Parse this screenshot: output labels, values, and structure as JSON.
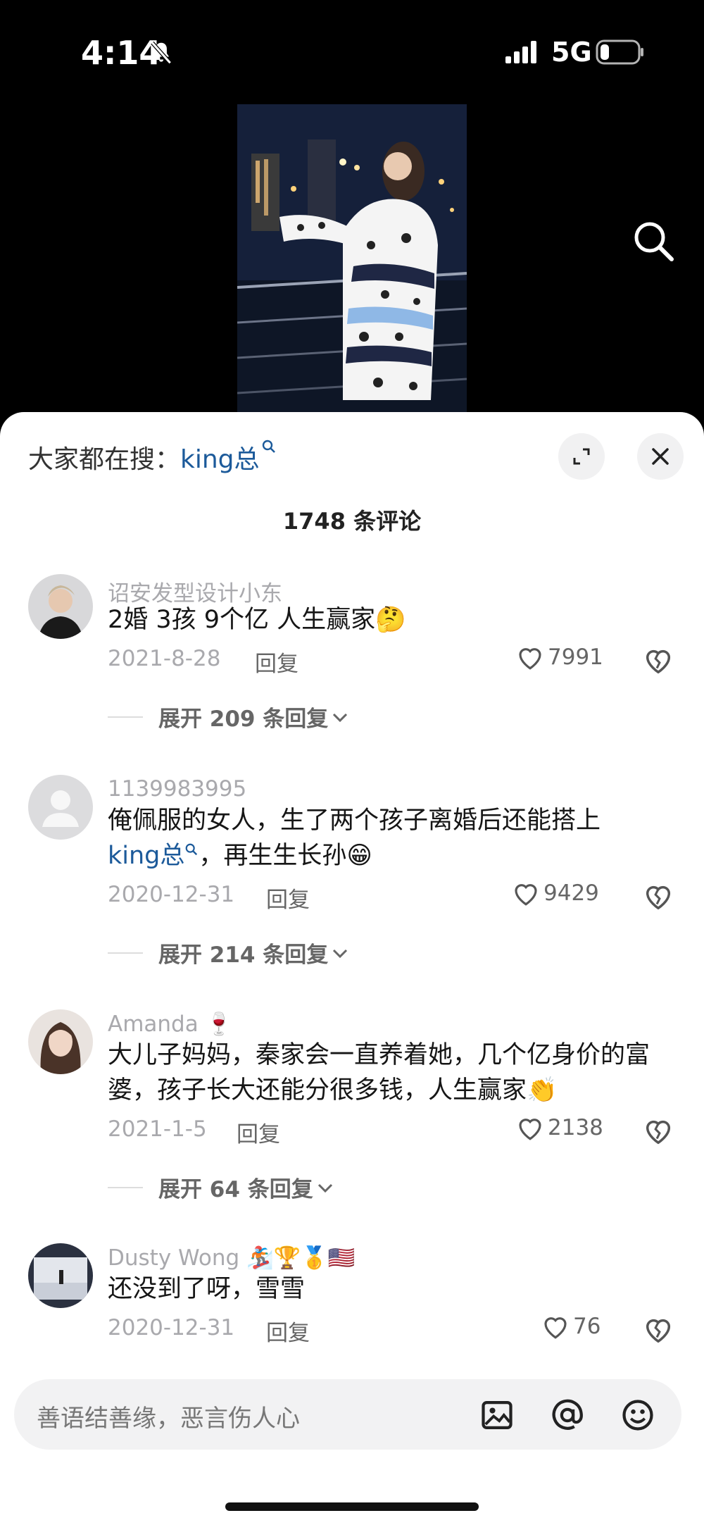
{
  "status_bar": {
    "time": "4:14",
    "network": "5G"
  },
  "hot_search": {
    "prefix": "大家都在搜：",
    "keyword": "king总"
  },
  "comments_header": {
    "count_title": "1748 条评论"
  },
  "comments": [
    {
      "username": "诏安发型设计小东",
      "text": "2婚 3孩 9个亿 人生赢家",
      "emoji": "🤔",
      "date": "2021-8-28",
      "reply_label": "回复",
      "likes": "7991",
      "expand_label": "展开 209 条回复"
    },
    {
      "username": "1139983995",
      "text_before": "俺佩服的女人，生了两个孩子离婚后还能搭上",
      "keyword": "king总",
      "text_after": "，再生生长孙",
      "emoji": "😁",
      "date": "2020-12-31",
      "reply_label": "回复",
      "likes": "9429",
      "expand_label": "展开 214 条回复"
    },
    {
      "username": "Amanda",
      "username_emoji": "🍷",
      "text": "大儿子妈妈，秦家会一直养着她，几个亿身价的富婆，孩子长大还能分很多钱，人生赢家",
      "emoji": "👏",
      "date": "2021-1-5",
      "reply_label": "回复",
      "likes": "2138",
      "expand_label": "展开 64 条回复"
    },
    {
      "username": "Dusty Wong",
      "username_emoji": "🏂🏆🥇🇺🇸",
      "text": "还没到了呀，雪雪",
      "date": "2020-12-31",
      "reply_label": "回复",
      "likes": "76"
    }
  ],
  "input": {
    "placeholder": "善语结善缘，恶言伤人心"
  },
  "colors": {
    "keyword": "#1c5a9a",
    "sheet_bg": "#ffffff",
    "muted": "#a9a9ad"
  }
}
